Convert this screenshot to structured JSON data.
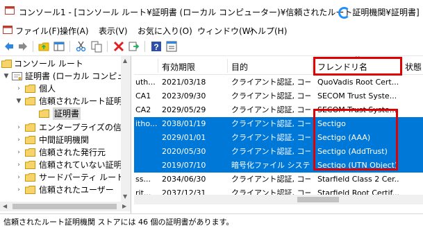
{
  "window": {
    "title": "コンソール1 - [コンソール ルート¥証明書 (ローカル コンピューター)¥信頼されたルート証明機関¥証明書]"
  },
  "menu": [
    "ファイル(F)",
    "操作(A)",
    "表示(V)",
    "お気に入り(O)",
    "ウィンドウ(W)",
    "ヘルプ(H)"
  ],
  "toolbar": [
    "back-icon",
    "forward-icon",
    "up-folder-icon",
    "show-hide-tree-icon",
    "cut-icon",
    "copy-icon",
    "delete-icon",
    "export-icon",
    "help-icon",
    "properties-icon"
  ],
  "tree": {
    "items": [
      {
        "label": "コンソール ルート"
      },
      {
        "label": "証明書 (ローカル コンピュータ"
      },
      {
        "label": "個人"
      },
      {
        "label": "信頼されたルート証明機"
      },
      {
        "label": "証明書"
      },
      {
        "label": "エンタープライズの信頼"
      },
      {
        "label": "中間証明機関"
      },
      {
        "label": "信頼された発行元"
      },
      {
        "label": "信頼されていない証明書"
      },
      {
        "label": "サードパーティ ルート証明"
      },
      {
        "label": "信頼されたユーザー"
      }
    ]
  },
  "columns": {
    "issued_by": "",
    "expires": "有効期限",
    "purpose": "目的",
    "friendly": "フレンドリ名",
    "status": "状態"
  },
  "rows": [
    {
      "issued_by": "uth...",
      "expires": "2021/03/18",
      "purpose": "クライアント認証, コー...",
      "friendly": "QuoVadis Root Cert...",
      "selected": false
    },
    {
      "issued_by": "CA1",
      "expires": "2023/09/30",
      "purpose": "クライアント認証, コー...",
      "friendly": "SECOM Trust Syste...",
      "selected": false
    },
    {
      "issued_by": "CA2",
      "expires": "2029/05/29",
      "purpose": "クライアント認証, コー...",
      "friendly": "SECOM Trust Syste...",
      "selected": false
    },
    {
      "issued_by": "itho...",
      "expires": "2038/01/19",
      "purpose": "クライアント認証, コー...",
      "friendly": "Sectigo",
      "selected": true
    },
    {
      "issued_by": "",
      "expires": "2029/01/01",
      "purpose": "クライアント認証, コー...",
      "friendly": "Sectigo (AAA)",
      "selected": true
    },
    {
      "issued_by": "",
      "expires": "2020/05/30",
      "purpose": "クライアント認証, コー...",
      "friendly": "Sectigo (AddTrust)",
      "selected": true
    },
    {
      "issued_by": "",
      "expires": "2019/07/10",
      "purpose": "暗号化ファイル システ...",
      "friendly": "Sectigo (UTN Object)",
      "selected": true
    },
    {
      "issued_by": "ss...",
      "expires": "2034/06/30",
      "purpose": "クライアント認証, コー...",
      "friendly": "Starfield Class 2 Cer...",
      "selected": false
    },
    {
      "issued_by": "rit...",
      "expires": "2037/12/31",
      "purpose": "クライアント認証, コー...",
      "friendly": "Starfield Root Certif...",
      "selected": false
    }
  ],
  "status": {
    "text": "信頼されたルート証明機関 ストアには 46 個の証明書があります。"
  },
  "colors": {
    "selection": "#0078d7",
    "highlight_box": "#e00000"
  }
}
